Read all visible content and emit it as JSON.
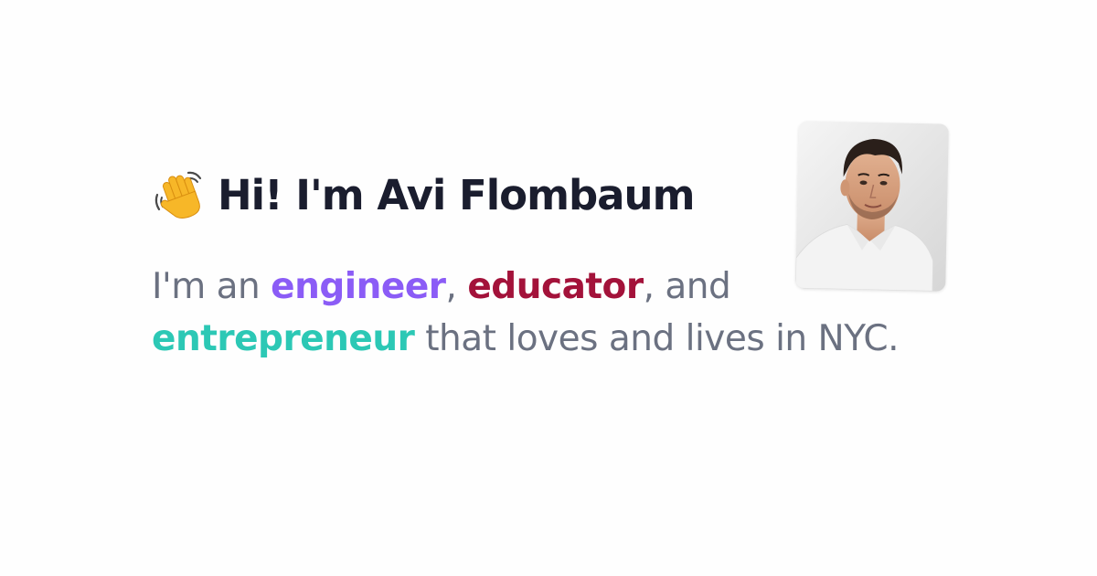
{
  "header": {
    "wave_icon": "waving-hand-icon",
    "title": "Hi! I'm Avi Flombaum"
  },
  "intro": {
    "prefix": "I'm an ",
    "role_1": "engineer",
    "sep_1": ", ",
    "role_2": "educator",
    "sep_2": ", and",
    "role_3": "entrepreneur",
    "suffix": " that loves and lives in NYC."
  },
  "avatar": {
    "icon": "profile-photo"
  },
  "colors": {
    "title": "#1a1d2e",
    "body_text": "#6b7181",
    "engineer": "#8b5cf6",
    "educator": "#a3123a",
    "entrepreneur": "#2cc8b5",
    "background": "#fefefe"
  }
}
